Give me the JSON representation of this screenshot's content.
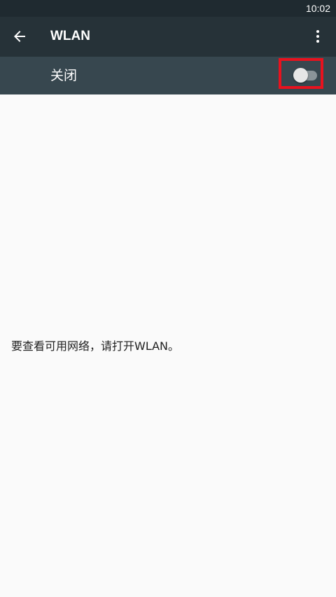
{
  "status_bar": {
    "time": "10:02"
  },
  "app_bar": {
    "back_icon": "arrow-left-icon",
    "title": "WLAN",
    "overflow_icon": "more-vertical-icon"
  },
  "wlan_switch": {
    "label": "关闭",
    "state": "off"
  },
  "main": {
    "empty_message": "要查看可用网络，请打开WLAN。"
  },
  "colors": {
    "status_bar": "#1f2a30",
    "app_bar": "#263238",
    "switch_bar": "#37474f",
    "highlight": "#e8121e",
    "background": "#fafafa"
  }
}
